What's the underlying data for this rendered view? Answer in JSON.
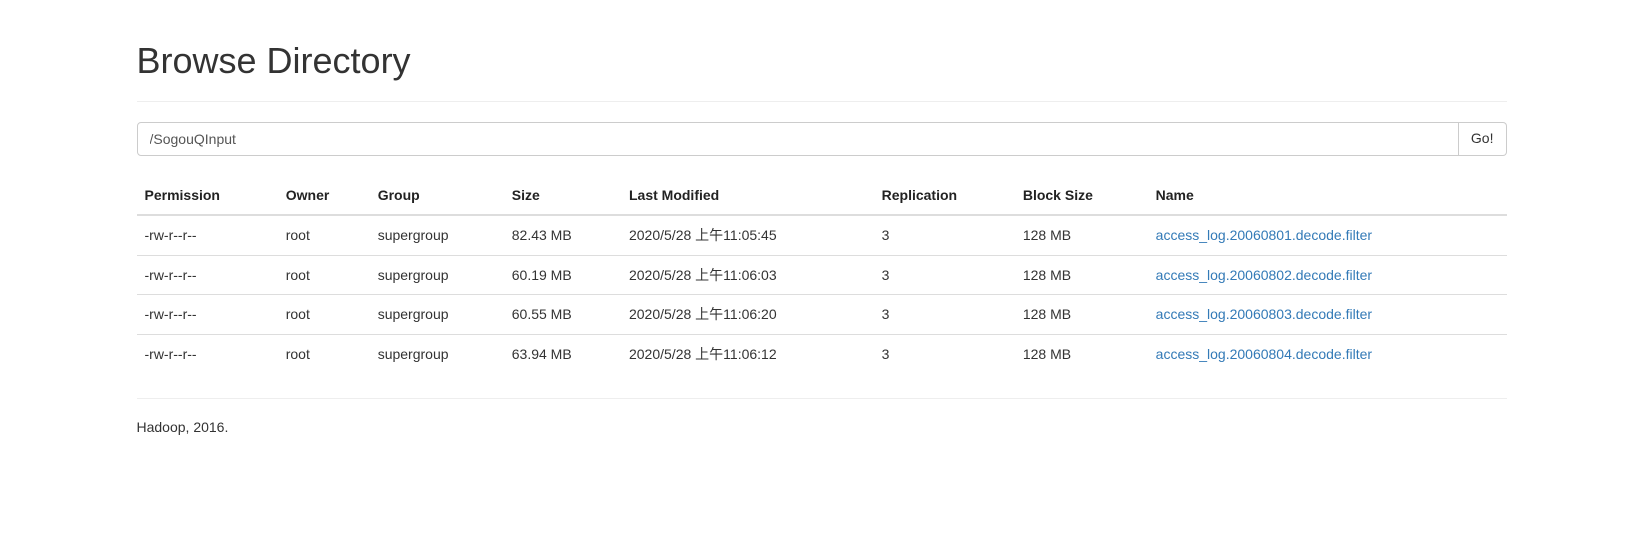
{
  "header": {
    "title": "Browse Directory"
  },
  "path_input": {
    "value": "/SogouQInput",
    "go_label": "Go!"
  },
  "table": {
    "headers": {
      "permission": "Permission",
      "owner": "Owner",
      "group": "Group",
      "size": "Size",
      "last_modified": "Last Modified",
      "replication": "Replication",
      "block_size": "Block Size",
      "name": "Name"
    },
    "rows": [
      {
        "permission": "-rw-r--r--",
        "owner": "root",
        "group": "supergroup",
        "size": "82.43 MB",
        "last_modified": "2020/5/28 上午11:05:45",
        "replication": "3",
        "block_size": "128 MB",
        "name": "access_log.20060801.decode.filter"
      },
      {
        "permission": "-rw-r--r--",
        "owner": "root",
        "group": "supergroup",
        "size": "60.19 MB",
        "last_modified": "2020/5/28 上午11:06:03",
        "replication": "3",
        "block_size": "128 MB",
        "name": "access_log.20060802.decode.filter"
      },
      {
        "permission": "-rw-r--r--",
        "owner": "root",
        "group": "supergroup",
        "size": "60.55 MB",
        "last_modified": "2020/5/28 上午11:06:20",
        "replication": "3",
        "block_size": "128 MB",
        "name": "access_log.20060803.decode.filter"
      },
      {
        "permission": "-rw-r--r--",
        "owner": "root",
        "group": "supergroup",
        "size": "63.94 MB",
        "last_modified": "2020/5/28 上午11:06:12",
        "replication": "3",
        "block_size": "128 MB",
        "name": "access_log.20060804.decode.filter"
      }
    ]
  },
  "footer": {
    "text": "Hadoop, 2016."
  }
}
